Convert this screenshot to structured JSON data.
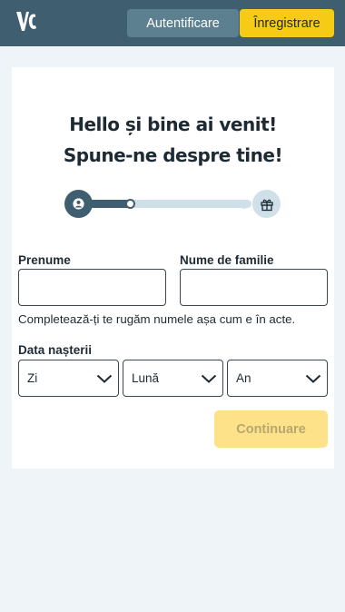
{
  "header": {
    "logo_text": "VC",
    "login_label": "Autentificare",
    "register_label": "Înregistrare",
    "brand_color": "#3f5f70",
    "accent_color": "#f6cb16"
  },
  "form": {
    "title_line1": "Hello și bine ai venit!",
    "title_line2": "Spune-ne despre tine!",
    "stepper": {
      "current_step": 1,
      "start_icon": "user-icon",
      "end_icon": "gift-icon"
    },
    "first_name": {
      "label": "Prenume",
      "value": "",
      "placeholder": ""
    },
    "last_name": {
      "label": "Nume de familie",
      "value": "",
      "placeholder": ""
    },
    "hint": "Completează-ți te rugăm numele așa cum e în acte.",
    "birthdate": {
      "label": "Data nașterii",
      "day": "Zi",
      "month": "Lună",
      "year": "An"
    },
    "continue_label": "Continuare"
  }
}
